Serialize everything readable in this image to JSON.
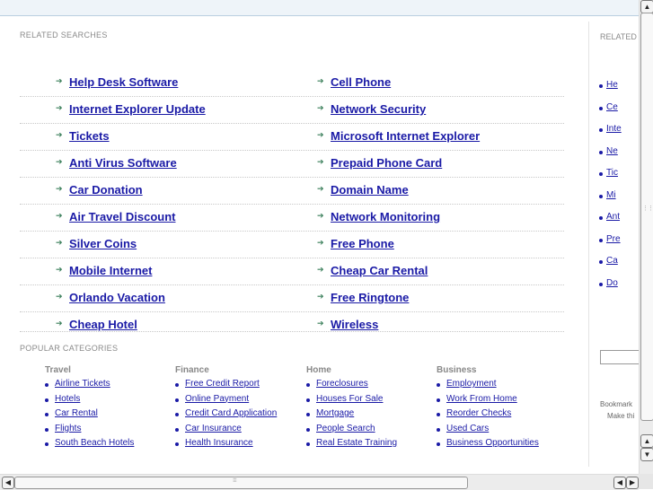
{
  "related_searches": {
    "title": "RELATED SEARCHES",
    "left": [
      "Help Desk Software",
      "Internet Explorer Update",
      "Tickets",
      "Anti Virus Software",
      "Car Donation",
      "Air Travel Discount",
      "Silver Coins",
      "Mobile Internet",
      "Orlando Vacation",
      "Cheap Hotel"
    ],
    "right": [
      "Cell Phone",
      "Network Security",
      "Microsoft Internet Explorer",
      "Prepaid Phone Card",
      "Domain Name",
      "Network Monitoring",
      "Free Phone",
      "Cheap Car Rental",
      "Free Ringtone",
      "Wireless"
    ],
    "arrow_icon": "arrow-right-icon"
  },
  "popular_categories": {
    "title": "POPULAR CATEGORIES",
    "columns": [
      {
        "heading": "Travel",
        "links": [
          "Airline Tickets",
          "Hotels",
          "Car Rental",
          "Flights",
          "South Beach Hotels"
        ]
      },
      {
        "heading": "Finance",
        "links": [
          "Free Credit Report",
          "Online Payment",
          "Credit Card Application",
          "Car Insurance",
          "Health Insurance"
        ]
      },
      {
        "heading": "Home",
        "links": [
          "Foreclosures",
          "Houses For Sale",
          "Mortgage",
          "People Search",
          "Real Estate Training"
        ]
      },
      {
        "heading": "Business",
        "links": [
          "Employment",
          "Work From Home",
          "Reorder Checks",
          "Used Cars",
          "Business Opportunities"
        ]
      }
    ]
  },
  "right_panel": {
    "title": "RELATED",
    "links": [
      "He",
      "Ce",
      "Inte",
      "Ne",
      "Tic",
      "Mi",
      "Ant",
      "Pre",
      "Ca",
      "Do"
    ],
    "bookmark_text": "Bookmark",
    "make_text": "Make thi"
  },
  "colors": {
    "link": "#1a1aa6",
    "arrow": "#3a7f5a",
    "topbar": "#eef4f9",
    "heading": "#888888"
  }
}
